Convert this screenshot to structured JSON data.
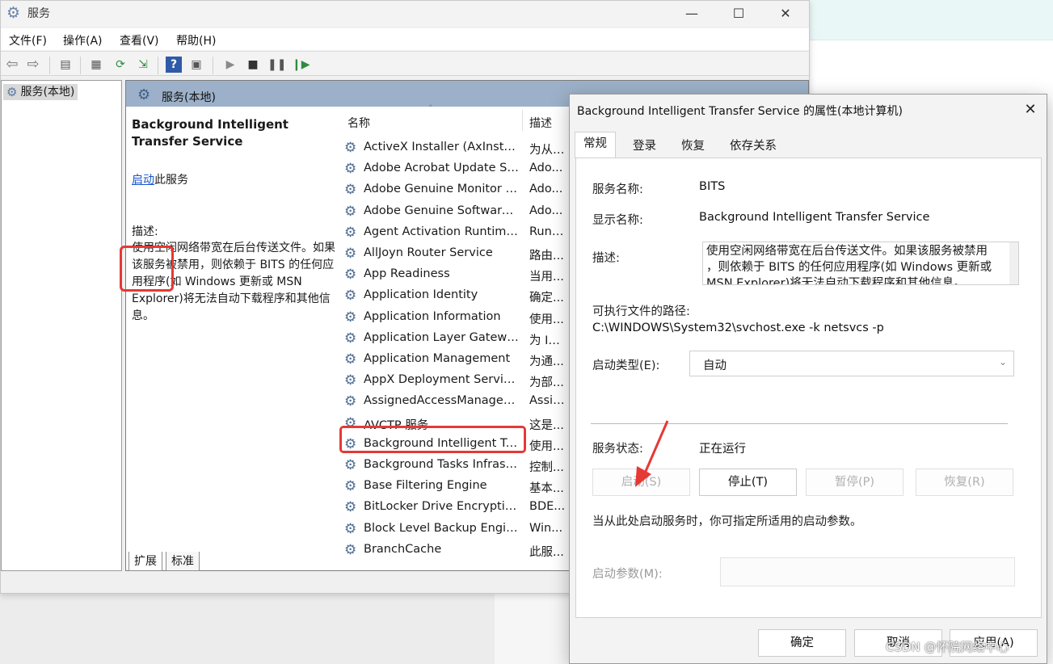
{
  "window": {
    "title": "服务",
    "controls": {
      "minimize": "—",
      "maximize": "☐",
      "close": "✕"
    }
  },
  "menu": [
    "文件(F)",
    "操作(A)",
    "查看(V)",
    "帮助(H)"
  ],
  "tree": {
    "item": "服务(本地)"
  },
  "main": {
    "header": "服务(本地)",
    "detail": {
      "title": "Background Intelligent Transfer Service",
      "start_link": "启动",
      "start_suffix": "此服务",
      "desc_label": "描述:",
      "desc": "使用空闲网络带宽在后台传送文件。如果该服务被禁用，则依赖于 BITS 的任何应用程序(如 Windows 更新或 MSN Explorer)将无法自动下载程序和其他信息。"
    },
    "columns": {
      "name": "名称",
      "desc": "描述",
      "sort_indicator": "˄"
    },
    "services": [
      {
        "name": "ActiveX Installer (AxInstSV)",
        "desc": "为从 ..."
      },
      {
        "name": "Adobe Acrobat Update Ser...",
        "desc": "Ado..."
      },
      {
        "name": "Adobe Genuine Monitor S...",
        "desc": "Ado..."
      },
      {
        "name": "Adobe Genuine Software I...",
        "desc": "Ado..."
      },
      {
        "name": "Agent Activation Runtime_...",
        "desc": "Runt..."
      },
      {
        "name": "AllJoyn Router Service",
        "desc": "路由..."
      },
      {
        "name": "App Readiness",
        "desc": "当用..."
      },
      {
        "name": "Application Identity",
        "desc": "确定..."
      },
      {
        "name": "Application Information",
        "desc": "使用..."
      },
      {
        "name": "Application Layer Gateway ...",
        "desc": "为 In..."
      },
      {
        "name": "Application Management",
        "desc": "为通..."
      },
      {
        "name": "AppX Deployment Service ...",
        "desc": "为部..."
      },
      {
        "name": "AssignedAccessManager ...",
        "desc": "Assig..."
      },
      {
        "name": "AVCTP 服务",
        "desc": "这是..."
      },
      {
        "name": "Background Intelligent Tra...",
        "desc": "使用..."
      },
      {
        "name": "Background Tasks Infrastru...",
        "desc": "控制..."
      },
      {
        "name": "Base Filtering Engine",
        "desc": "基本..."
      },
      {
        "name": "BitLocker Drive Encryption ...",
        "desc": "BDE..."
      },
      {
        "name": "Block Level Backup Engine ...",
        "desc": "Win..."
      },
      {
        "name": "BranchCache",
        "desc": "此服..."
      }
    ],
    "bottom_tabs": [
      "扩展",
      "标准"
    ]
  },
  "dialog": {
    "title": "Background Intelligent Transfer Service 的属性(本地计算机)",
    "tabs": [
      "常规",
      "登录",
      "恢复",
      "依存关系"
    ],
    "service_name_label": "服务名称:",
    "service_name": "BITS",
    "display_name_label": "显示名称:",
    "display_name": "Background Intelligent Transfer Service",
    "desc_label": "描述:",
    "desc_line1": "使用空闲网络带宽在后台传送文件。如果该服务被禁用",
    "desc_line2": "，则依赖于 BITS 的任何应用程序(如 Windows 更新或",
    "desc_line3": "MSN Explorer)将无法自动下载程序和其他信息。",
    "path_label": "可执行文件的路径:",
    "path": "C:\\WINDOWS\\System32\\svchost.exe -k netsvcs -p",
    "startup_label": "启动类型(E):",
    "startup_value": "自动",
    "status_label": "服务状态:",
    "status_value": "正在运行",
    "buttons": {
      "start": "启动(S)",
      "stop": "停止(T)",
      "pause": "暂停(P)",
      "resume": "恢复(R)"
    },
    "hint": "当从此处启动服务时，你可指定所适用的启动参数。",
    "param_label": "启动参数(M):",
    "ok": "确定",
    "cancel": "取消",
    "apply": "应用(A)"
  },
  "watermark": "CSDN @怀院网络中心",
  "colors": {
    "highlight": "#e53935",
    "header": "#9cb1c9",
    "link": "#1a55cc"
  }
}
